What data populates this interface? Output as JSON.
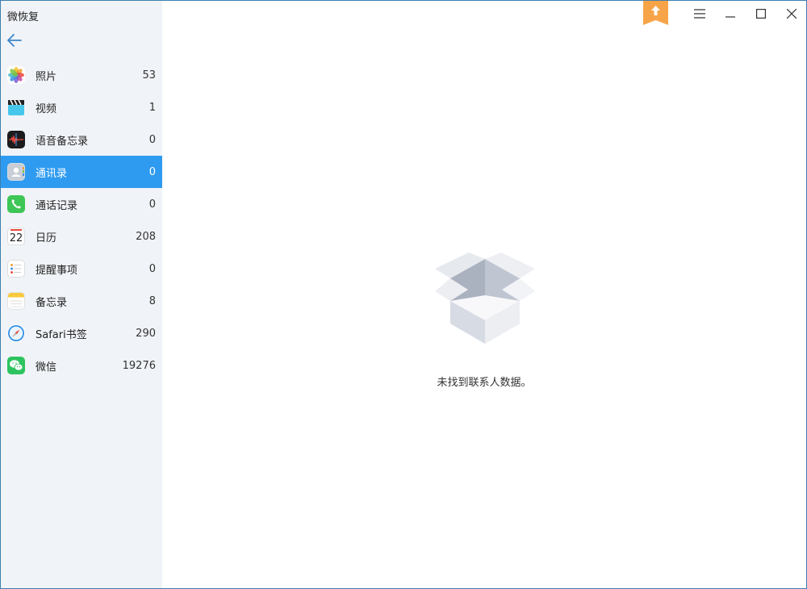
{
  "app": {
    "title": "微恢复"
  },
  "nav": {
    "items": [
      {
        "label": "照片",
        "count": "53",
        "icon": "photos-icon"
      },
      {
        "label": "视频",
        "count": "1",
        "icon": "video-clapper-icon"
      },
      {
        "label": "语音备忘录",
        "count": "0",
        "icon": "voice-memo-icon"
      },
      {
        "label": "通讯录",
        "count": "0",
        "icon": "contacts-icon"
      },
      {
        "label": "通话记录",
        "count": "0",
        "icon": "phone-icon"
      },
      {
        "label": "日历",
        "count": "208",
        "icon": "calendar-icon"
      },
      {
        "label": "提醒事项",
        "count": "0",
        "icon": "reminders-icon"
      },
      {
        "label": "备忘录",
        "count": "8",
        "icon": "notes-icon"
      },
      {
        "label": "Safari书签",
        "count": "290",
        "icon": "safari-icon"
      },
      {
        "label": "微信",
        "count": "19276",
        "icon": "wechat-icon"
      }
    ],
    "active_index": 3,
    "calendar_day": "22"
  },
  "main": {
    "empty_message": "未找到联系人数据。"
  },
  "colors": {
    "accent": "#2f9bf0",
    "sidebar_bg": "#f0f3f7",
    "upgrade_badge": "#f7a448"
  }
}
